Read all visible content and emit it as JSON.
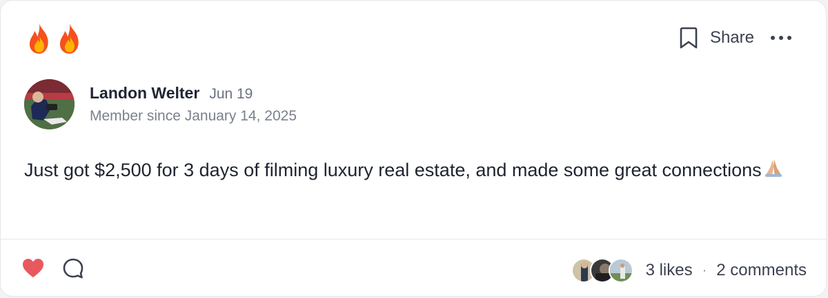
{
  "post": {
    "title_icons": [
      "fire-icon",
      "fire-icon"
    ],
    "actions": {
      "bookmark_icon": "bookmark-icon",
      "share_label": "Share",
      "more_icon": "more-horizontal-icon"
    },
    "author": {
      "name": "Landon Welter",
      "date": "Jun 19",
      "member_since": "Member since January 14, 2025"
    },
    "body_text": "Just got $2,500 for 3 days of filming luxury real estate, and made some great connections",
    "body_emoji": "folded-hands-icon",
    "footer": {
      "like_icon": "heart-icon",
      "comment_icon": "comment-icon",
      "likes": "3 likes",
      "separator": "·",
      "comments": "2 comments"
    }
  },
  "colors": {
    "heart": "#e8585f",
    "text": "#1f2430",
    "muted": "#6b7280",
    "flame_outer": "#f4511e",
    "flame_inner": "#ffb300"
  }
}
